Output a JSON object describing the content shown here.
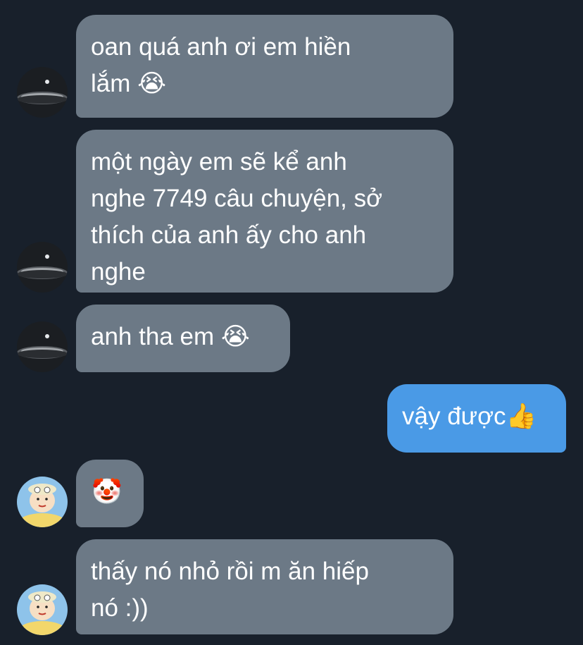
{
  "messages": [
    {
      "sender": "them",
      "avatar": "dark-orb-avatar",
      "text": "oan quá anh ơi em hiền\nlắm 😭"
    },
    {
      "sender": "them",
      "avatar": "dark-orb-avatar",
      "text": "một ngày em sẽ kể anh\nnghe 7749 câu chuyện, sở\nthích của anh ấy cho anh\nnghe"
    },
    {
      "sender": "them",
      "avatar": "dark-orb-avatar",
      "text": "anh tha em 😭"
    },
    {
      "sender": "me",
      "text": "vậy được👍"
    },
    {
      "sender": "other",
      "avatar": "cartoon-boy-avatar",
      "text": "🤡"
    },
    {
      "sender": "other",
      "avatar": "cartoon-boy-avatar",
      "text": "thấy nó nhỏ rồi m ăn hiếp\nnó :))"
    }
  ],
  "colors": {
    "background": "#18202b",
    "incoming_bubble": "#6c7986",
    "outgoing_bubble": "#4a9ae6",
    "text": "#ffffff"
  }
}
